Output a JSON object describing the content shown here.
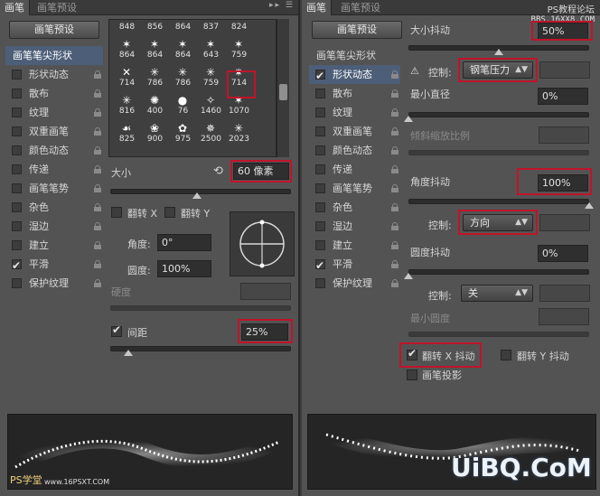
{
  "left": {
    "tabs": [
      "画笔",
      "画笔预设"
    ],
    "preset_button": "画笔预设",
    "side": [
      {
        "label": "画笔笔尖形状",
        "type": "header",
        "checked": false,
        "lock": false
      },
      {
        "label": "形状动态",
        "checked": false,
        "lock": true
      },
      {
        "label": "散布",
        "checked": false,
        "lock": true
      },
      {
        "label": "纹理",
        "checked": false,
        "lock": true
      },
      {
        "label": "双重画笔",
        "checked": false,
        "lock": true
      },
      {
        "label": "颜色动态",
        "checked": false,
        "lock": true
      },
      {
        "label": "传递",
        "checked": false,
        "lock": true
      },
      {
        "label": "画笔笔势",
        "checked": false,
        "lock": true
      },
      {
        "label": "杂色",
        "checked": false,
        "lock": true
      },
      {
        "label": "湿边",
        "checked": false,
        "lock": true
      },
      {
        "label": "建立",
        "checked": false,
        "lock": true
      },
      {
        "label": "平滑",
        "checked": true,
        "lock": true
      },
      {
        "label": "保护纹理",
        "checked": false,
        "lock": true
      }
    ],
    "brush_sizes": [
      [
        "848",
        "856",
        "864",
        "837",
        "824"
      ],
      [
        "864",
        "864",
        "864",
        "643",
        "759"
      ],
      [
        "714",
        "786",
        "786",
        "759",
        "714"
      ],
      [
        "816",
        "400",
        "76",
        "1460",
        "1070"
      ],
      [
        "825",
        "900",
        "975",
        "2500",
        "2023"
      ]
    ],
    "size_label": "大小",
    "size_value": "60 像素",
    "size_pct": 0.48,
    "flip_x": "翻转 X",
    "flip_y": "翻转 Y",
    "angle_label": "角度:",
    "angle_value": "0°",
    "roundness_label": "圆度:",
    "roundness_value": "100%",
    "hardness_label": "硬度",
    "spacing_label": "间距",
    "spacing_checked": true,
    "spacing_value": "25%",
    "spacing_pct": 0.1,
    "watermark": "PS学堂",
    "watermark_url": "www.16PSXT.COM"
  },
  "right": {
    "tabs": [
      "画笔",
      "画笔预设"
    ],
    "preset_button": "画笔预设",
    "side": [
      {
        "label": "画笔笔尖形状",
        "type": "plain",
        "checked": false,
        "lock": false
      },
      {
        "label": "形状动态",
        "type": "hl",
        "checked": true,
        "lock": true
      },
      {
        "label": "散布",
        "checked": false,
        "lock": true
      },
      {
        "label": "纹理",
        "checked": false,
        "lock": true
      },
      {
        "label": "双重画笔",
        "checked": false,
        "lock": true
      },
      {
        "label": "颜色动态",
        "checked": false,
        "lock": true
      },
      {
        "label": "传递",
        "checked": false,
        "lock": true
      },
      {
        "label": "画笔笔势",
        "checked": false,
        "lock": true
      },
      {
        "label": "杂色",
        "checked": false,
        "lock": true
      },
      {
        "label": "湿边",
        "checked": false,
        "lock": true
      },
      {
        "label": "建立",
        "checked": false,
        "lock": true
      },
      {
        "label": "平滑",
        "checked": true,
        "lock": true
      },
      {
        "label": "保护纹理",
        "checked": false,
        "lock": true
      }
    ],
    "size_jitter_label": "大小抖动",
    "size_jitter_value": "50%",
    "size_jitter_pct": 0.5,
    "control_label": "控制:",
    "control_pen": "钢笔压力",
    "min_diameter_label": "最小直径",
    "min_diameter_value": "0%",
    "min_diameter_pct": 0.0,
    "tilt_scale_label": "倾斜缩放比例",
    "angle_jitter_label": "角度抖动",
    "angle_jitter_value": "100%",
    "angle_jitter_pct": 1.0,
    "control_direction": "方向",
    "roundness_jitter_label": "圆度抖动",
    "roundness_jitter_value": "0%",
    "roundness_jitter_pct": 0.0,
    "control_off": "关",
    "min_roundness_label": "最小圆度",
    "flip_x_jitter": "翻转 X 抖动",
    "flip_y_jitter": "翻转 Y 抖动",
    "brush_projection": "画笔投影",
    "watermark_site": "PS教程论坛",
    "watermark_bbs": "BBS.16XX8.COM",
    "watermark_brand": "UiBQ.CoM"
  },
  "colors": {
    "accent_red": "#c0142a",
    "highlight": "#4d5e78",
    "panel_bg": "#535353"
  }
}
